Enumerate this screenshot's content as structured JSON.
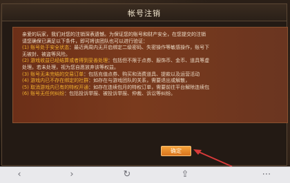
{
  "dialog": {
    "title": "帐号注销",
    "intro": [
      "亲爱的玩家，我们对您的注销深表遗憾。为保证您的账号和财产安全，在您提交的注销",
      "请您确保已满足以下条件，即可将该团队也可以进行验证："
    ],
    "items": [
      {
        "tag": "(1) 账号处于安全状态",
        "text": "：最近两周内无开启绑定二级密码、失密操作等敏感操作，账号下",
        "cont": "无被封、被盗等风险。"
      },
      {
        "tag": "(2) 游戏收益已经结算或者得到妥善处理",
        "text": "：包括但不限于点券、服饰币、金币、道具等虚",
        "cont": "处理。若未处理，视为您自愿放弃该等权益。"
      },
      {
        "tag": "(3) 账号无未完结的交易订单",
        "text": "：包括充值点券、购买和消费道具、提款以及运营活动",
        "cont": ""
      },
      {
        "tag": "(4) 游戏内已不存在绑定的社群",
        "text": "：如存在与游戏团队的关系，需要退出或解散，",
        "cont": ""
      },
      {
        "tag": "(5) 取消游戏内已有的特权开通",
        "text": "：如存在连续包月的特权订单，需要前往平台解除连续包",
        "cont": ""
      },
      {
        "tag": "(6) 账号无任何纠纷",
        "text": "：包括投诉举报、被投诉举报、仲裁、诉讼等纠纷。",
        "cont": ""
      }
    ],
    "confirm_label": "确定"
  },
  "nav": {
    "back": "‹",
    "forward": "›",
    "reload": "↻",
    "share": "⇪",
    "menu": "⋯"
  },
  "colors": {
    "accent_orange": "#f1b12e",
    "content_bg": "#7a3a1d",
    "dialog_bg": "#231a14",
    "button": "#e88a2a"
  }
}
